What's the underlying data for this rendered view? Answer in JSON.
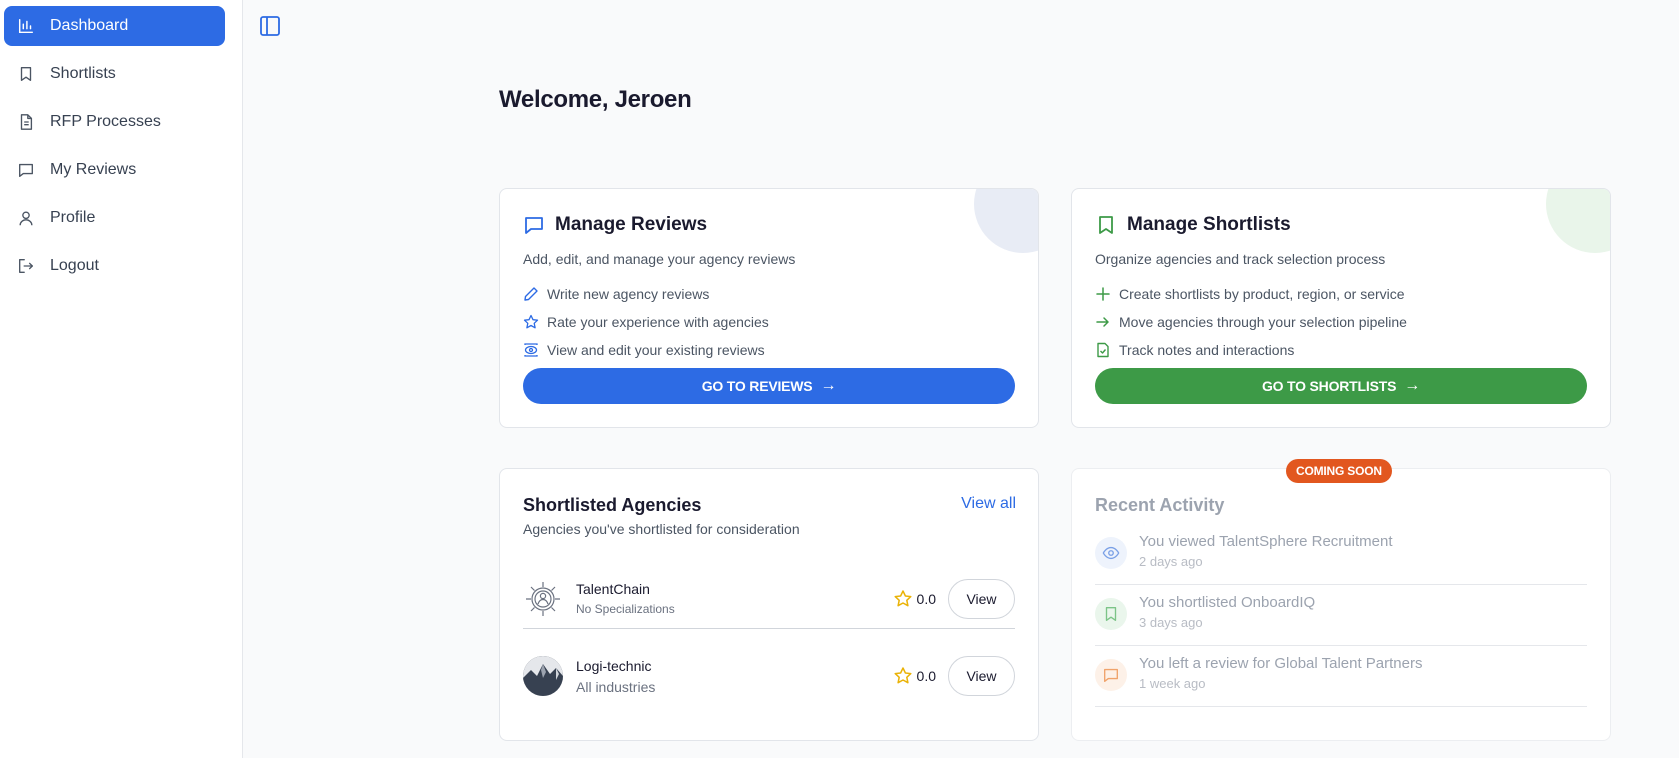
{
  "sidebar": {
    "items": [
      {
        "label": "Dashboard",
        "icon": "bar-chart-icon",
        "active": true
      },
      {
        "label": "Shortlists",
        "icon": "bookmark-icon"
      },
      {
        "label": "RFP Processes",
        "icon": "document-icon"
      },
      {
        "label": "My Reviews",
        "icon": "message-icon"
      },
      {
        "label": "Profile",
        "icon": "user-icon"
      },
      {
        "label": "Logout",
        "icon": "logout-icon"
      }
    ]
  },
  "header": {
    "welcome": "Welcome, Jeroen",
    "toggle_icon": "sidebar-toggle-icon"
  },
  "reviews_card": {
    "title": "Manage Reviews",
    "subtitle": "Add, edit, and manage your agency reviews",
    "features": [
      "Write new agency reviews",
      "Rate your experience with agencies",
      "View and edit your existing reviews"
    ],
    "button": "GO TO REVIEWS",
    "accent": "#2d6be4"
  },
  "shortlists_card": {
    "title": "Manage Shortlists",
    "subtitle": "Organize agencies and track selection process",
    "features": [
      "Create shortlists by product, region, or service",
      "Move agencies through your selection pipeline",
      "Track notes and interactions"
    ],
    "button": "GO TO SHORTLISTS",
    "accent": "#3d9a47"
  },
  "agencies": {
    "title": "Shortlisted Agencies",
    "subtitle": "Agencies you've shortlisted for consideration",
    "view_all": "View all",
    "rows": [
      {
        "name": "TalentChain",
        "meta": "No Specializations",
        "rating": "0.0",
        "action": "View"
      },
      {
        "name": "Logi-technic",
        "meta": "All industries",
        "rating": "0.0",
        "action": "View"
      }
    ]
  },
  "activity": {
    "badge": "COMING SOON",
    "title": "Recent Activity",
    "items": [
      {
        "text": "You viewed TalentSphere Recruitment",
        "time": "2 days ago",
        "icon": "eye-icon"
      },
      {
        "text": "You shortlisted OnboardIQ",
        "time": "3 days ago",
        "icon": "bookmark-icon"
      },
      {
        "text": "You left a review for Global Talent Partners",
        "time": "1 week ago",
        "icon": "message-icon"
      }
    ]
  }
}
